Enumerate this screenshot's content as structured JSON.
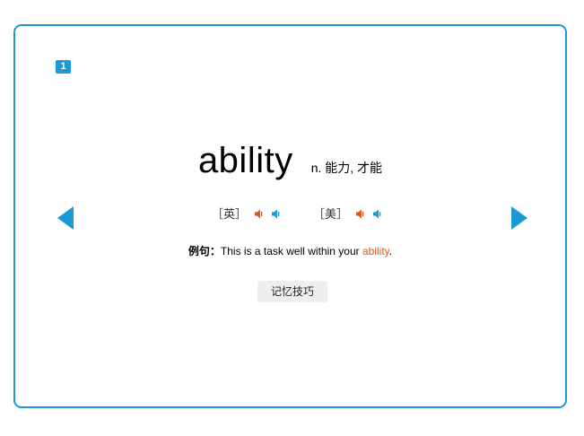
{
  "card": {
    "index": "1",
    "word": "ability",
    "part_of_speech": "n. 能力, 才能",
    "pronunciations": [
      {
        "label": "［英］",
        "region": "uk"
      },
      {
        "label": "［美］",
        "region": "us"
      }
    ],
    "example": {
      "prefix": "例句：",
      "before": "This is a task well within your ",
      "highlight": "ability",
      "after": "."
    },
    "tips_button": "记忆技巧"
  },
  "colors": {
    "accent": "#1a99d6",
    "highlight": "#e0561a",
    "speaker_slow": "#e0561a",
    "speaker_normal": "#1a99d6"
  },
  "icons": {
    "prev": "triangle-left-icon",
    "next": "triangle-right-icon",
    "speaker": "speaker-icon"
  }
}
